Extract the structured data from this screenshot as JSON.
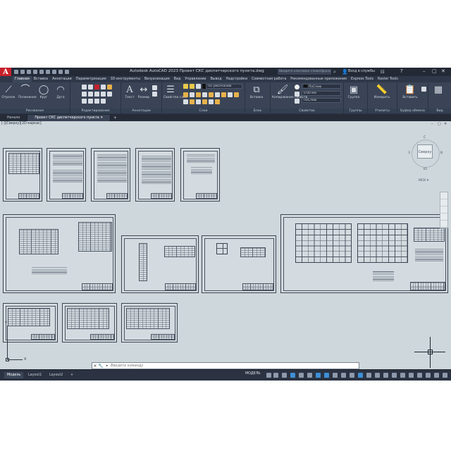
{
  "app": {
    "logo_letter": "A",
    "title": "Autodesk AutoCAD 2023    Проект СКС диспетчерского пункта.dwg",
    "search_placeholder": "Введите ключевое слово/фразу",
    "signin": "Вход в службы",
    "help": "?"
  },
  "ribbon_tabs": [
    "Главная",
    "Вставка",
    "Аннотации",
    "Параметризация",
    "3D-инструменты",
    "Визуализация",
    "Вид",
    "Управление",
    "Вывод",
    "Надстройки",
    "Совместная работа",
    "Рекомендованные приложения",
    "Express Tools",
    "Raster Tools"
  ],
  "ribbon": {
    "draw": {
      "label": "Рисование",
      "line": "Отрезок",
      "polyline": "Полилиния",
      "circle": "Круг",
      "arc": "Дуга"
    },
    "modify": {
      "label": "Редактирование"
    },
    "annotation": {
      "label": "Аннотации",
      "text": "Текст",
      "dimension": "Размер"
    },
    "layers": {
      "label": "Слои",
      "properties": "Свойства слоя",
      "current_layer": "По умолчанию"
    },
    "block": {
      "label": "Блок",
      "insert": "Вставка"
    },
    "properties": {
      "label": "Свойства",
      "match": "Копирование свойств",
      "color": "ПоСлою",
      "lineweight": "0.00 мм",
      "linetype": "ПоСлою"
    },
    "groups": {
      "label": "Группы",
      "group": "Группа"
    },
    "utilities": {
      "label": "Утилиты",
      "measure": "Измерить"
    },
    "clipboard": {
      "label": "Буфер обмена",
      "paste": "Вставить"
    },
    "view": {
      "label": "Вид"
    }
  },
  "file_tabs": {
    "start": "Начало",
    "document": "Проект СКС диспетчерского пункта",
    "add": "+"
  },
  "viewport": {
    "label": "[-][Сверху][2D-каркас]",
    "viewcube_face": "Сверху",
    "viewcube_n": "С",
    "viewcube_s": "Ю",
    "viewcube_w": "З",
    "viewcube_e": "В",
    "wcs": "МСК ▾"
  },
  "ucs": {
    "x": "X",
    "y": "Y"
  },
  "command": {
    "placeholder": "Введите команду"
  },
  "status": {
    "layouts": [
      "Модель",
      "Layout1",
      "Layout2"
    ],
    "add_layout": "+",
    "model": "МОДЕЛЬ"
  }
}
